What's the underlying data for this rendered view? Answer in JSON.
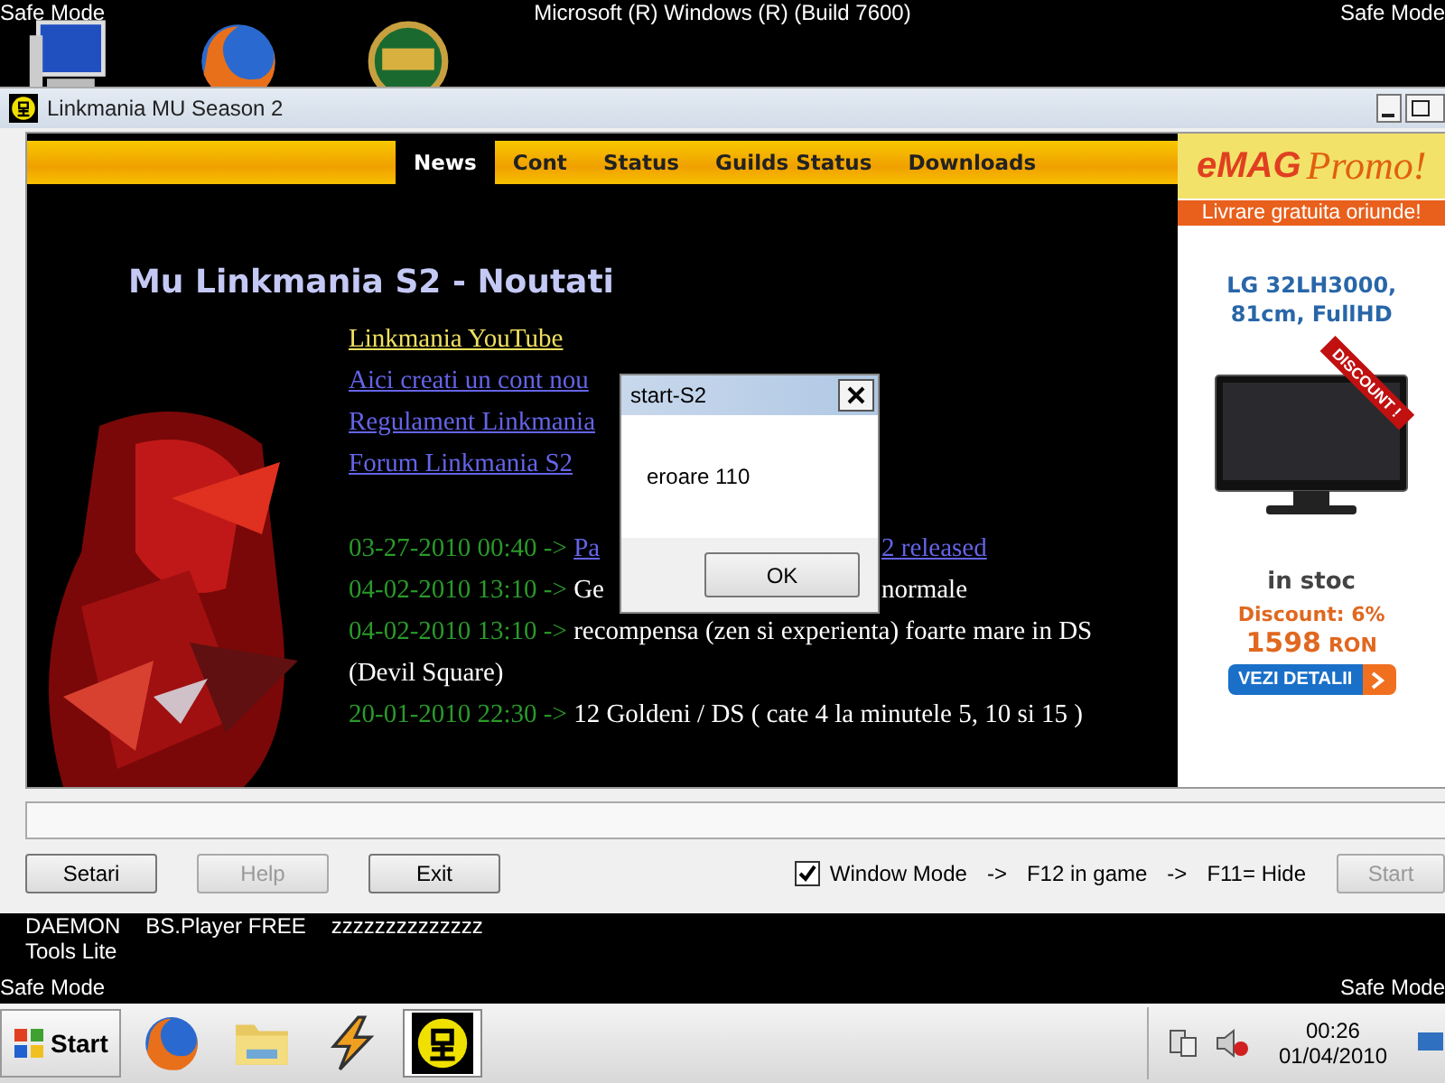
{
  "desktop": {
    "mode_label_left": "Safe Mode",
    "title": "Microsoft (R) Windows (R) (Build 7600)",
    "mode_label_right": "Safe Mode",
    "shortcuts": [
      {
        "kind": "computer"
      },
      {
        "kind": "firefox"
      },
      {
        "kind": "hon"
      }
    ],
    "lower_shortcuts": [
      {
        "lines": [
          "DAEMON",
          "Tools Lite"
        ]
      },
      {
        "lines": [
          "BS.Player FREE"
        ]
      },
      {
        "lines": [
          "zzzzzzzzzzzzzz"
        ]
      }
    ],
    "bottom_label_left": "Safe Mode",
    "bottom_label_right": "Safe Mode"
  },
  "window": {
    "title": "Linkmania MU Season 2"
  },
  "browser": {
    "nav": [
      {
        "label": "News",
        "selected": true
      },
      {
        "label": "Cont",
        "selected": false
      },
      {
        "label": "Status",
        "selected": false
      },
      {
        "label": "Guilds Status",
        "selected": false
      },
      {
        "label": "Downloads",
        "selected": false
      }
    ],
    "heading": "Mu Linkmania S2 - Noutati",
    "links": [
      {
        "text": "Linkmania YouTube",
        "highlighted": true
      },
      {
        "text": "Aici creati un cont nou",
        "highlighted": false
      },
      {
        "text": "Regulament Linkmania",
        "highlighted": false
      },
      {
        "text": "Forum Linkmania S2",
        "highlighted": false
      }
    ],
    "news": [
      {
        "date": "03-27-2010 00:40 ->",
        "text": "Pa",
        "link": true,
        "after": "2 released"
      },
      {
        "date": "04-02-2010 13:10 ->",
        "text": "Ge",
        "link": false,
        "after": "normale"
      },
      {
        "date": "04-02-2010 13:10 ->",
        "text": "recompensa (zen si experienta) foarte mare in DS (Devil Square)",
        "link": false
      },
      {
        "date": "20-01-2010 22:30 ->",
        "text": "12 Goldeni / DS ( cate 4 la minutele 5, 10 si 15 )",
        "link": false
      }
    ]
  },
  "ad": {
    "logo": "eMAG",
    "logo_tail": "Promo!",
    "slogan": "Livrare gratuita oriunde!",
    "product": "LG 32LH3000, 81cm, FullHD",
    "ribbon": "DISCOUNT !",
    "availability": "in stoc",
    "discount": "Discount: 6%",
    "price": "1598",
    "currency": "RON",
    "button": "VEZI DETALII"
  },
  "launcher": {
    "buttons": [
      {
        "label": "Setari",
        "disabled": false
      },
      {
        "label": "Help",
        "disabled": true
      },
      {
        "label": "Exit",
        "disabled": false
      }
    ],
    "window_mode": {
      "label": "Window Mode",
      "checked": true
    },
    "hints": [
      "->",
      "F12 in game",
      "->",
      "F11= Hide"
    ],
    "start": {
      "label": "Start",
      "disabled": true
    }
  },
  "dialog": {
    "title": "start-S2",
    "message": "eroare 110",
    "button": "OK"
  },
  "taskbar": {
    "start": "Start",
    "apps": [
      {
        "kind": "firefox",
        "active": false
      },
      {
        "kind": "explorer",
        "active": false
      },
      {
        "kind": "winamp",
        "active": false
      },
      {
        "kind": "linkmania",
        "active": true
      }
    ],
    "time": "00:26",
    "date": "01/04/2010"
  }
}
